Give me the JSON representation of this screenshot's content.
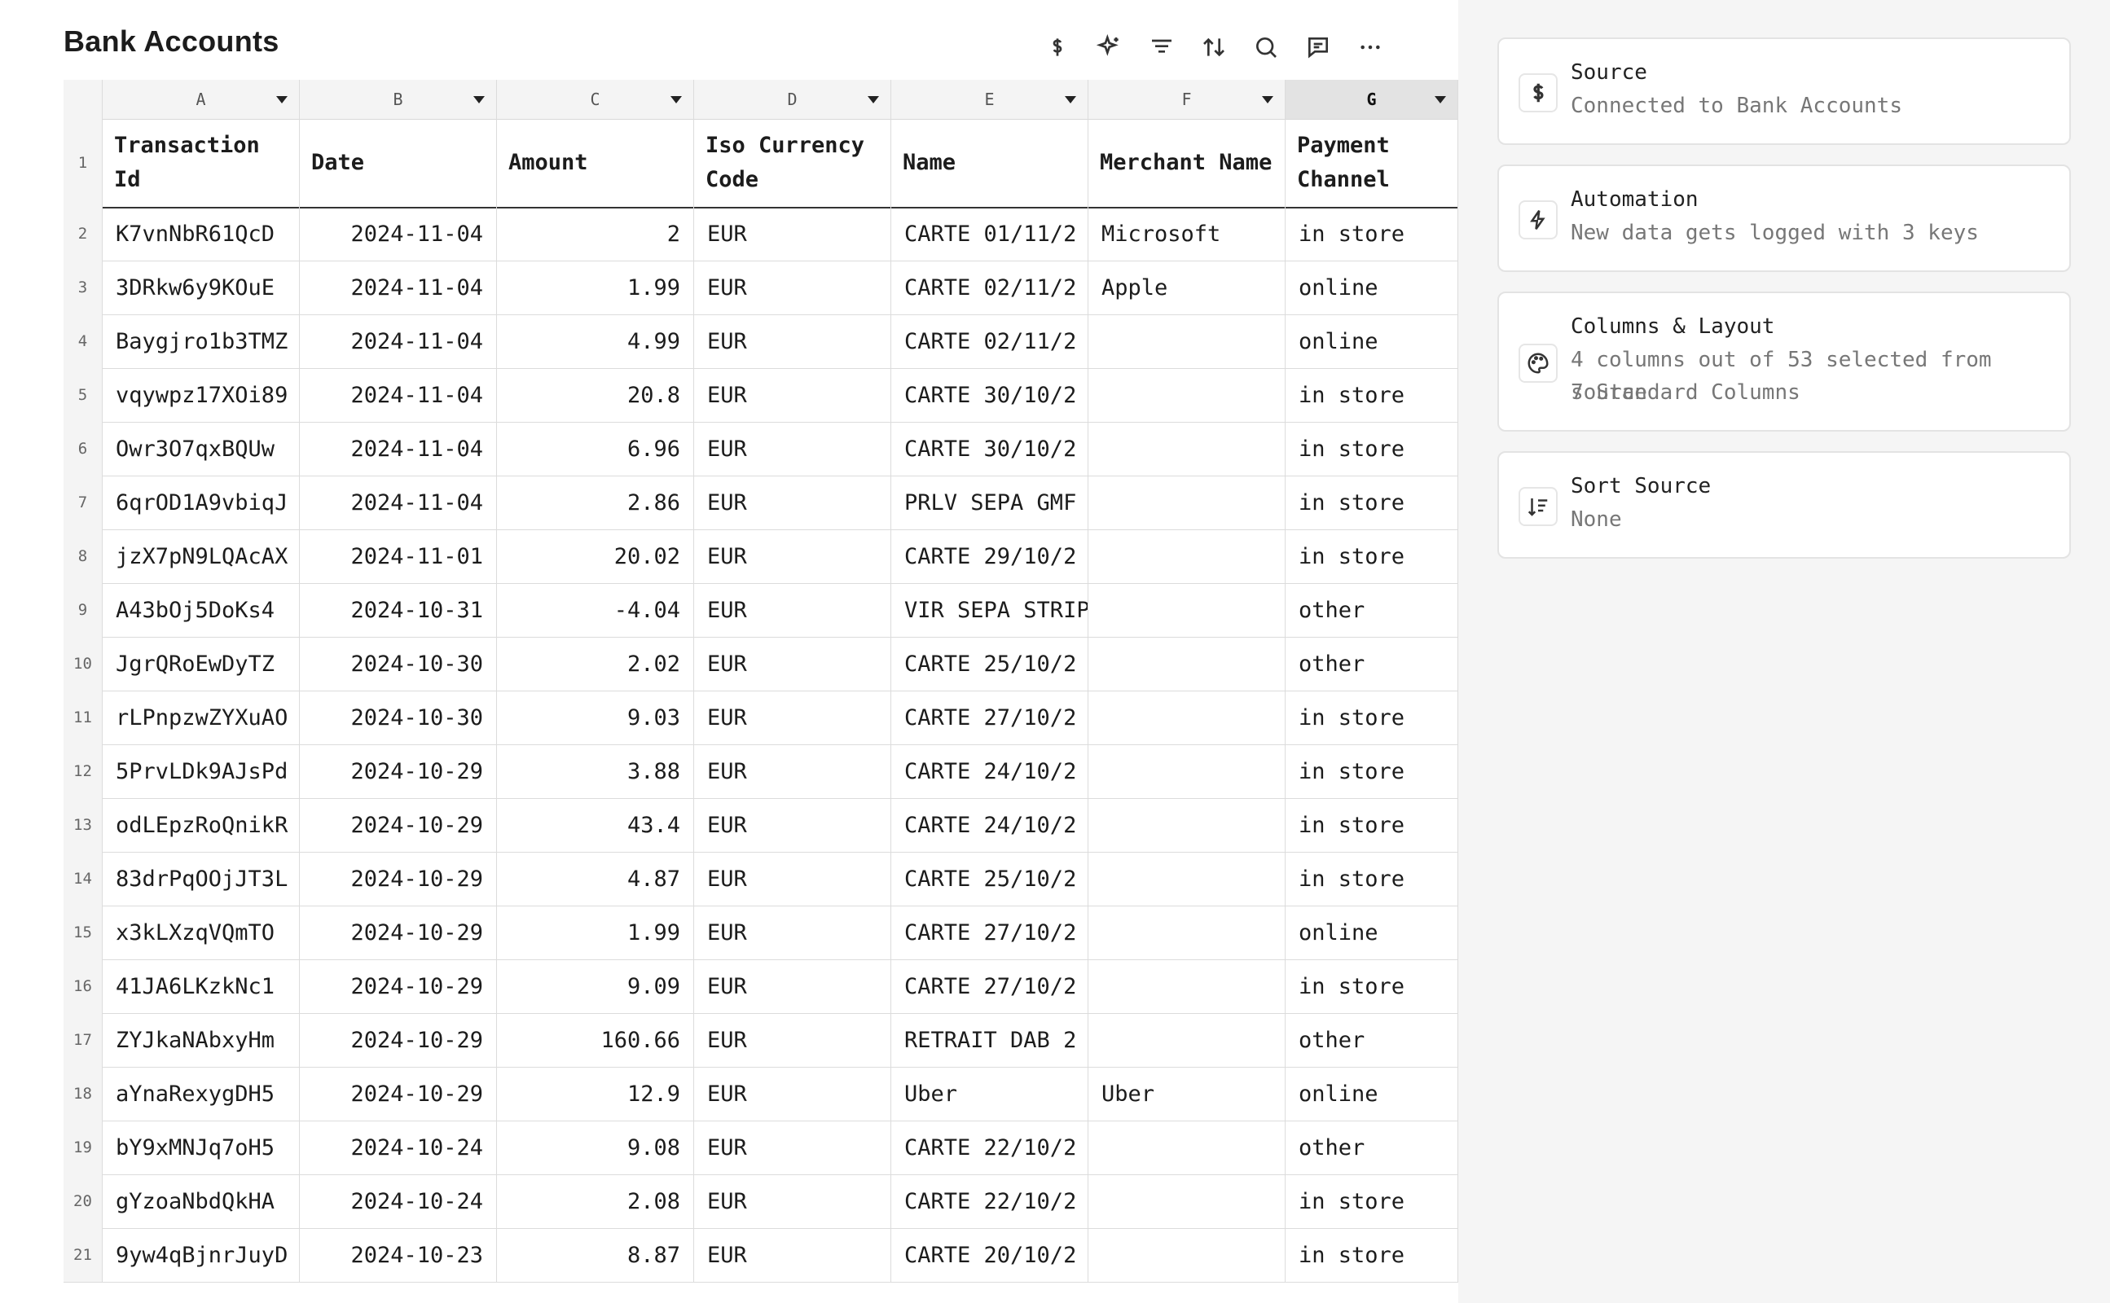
{
  "page_title": "Bank Accounts",
  "toolbar": {
    "icons": [
      "dollar-icon",
      "sparkle-icon",
      "filter-icon",
      "sort-icon",
      "search-icon",
      "comment-icon",
      "more-icon"
    ]
  },
  "columns": [
    {
      "letter": "A",
      "header": "Transaction Id"
    },
    {
      "letter": "B",
      "header": "Date"
    },
    {
      "letter": "C",
      "header": "Amount"
    },
    {
      "letter": "D",
      "header": "Iso Currency Code"
    },
    {
      "letter": "E",
      "header": "Name"
    },
    {
      "letter": "F",
      "header": "Merchant Name"
    },
    {
      "letter": "G",
      "header": "Payment Channel"
    }
  ],
  "header_row_number": "1",
  "rows": [
    {
      "n": "2",
      "id": "K7vnNbR61QcD",
      "date": "2024-11-04",
      "amount": "2",
      "cur": "EUR",
      "name": "CARTE 01/11/2",
      "merchant": "Microsoft",
      "channel": "in store"
    },
    {
      "n": "3",
      "id": "3DRkw6y9KOuE",
      "date": "2024-11-04",
      "amount": "1.99",
      "cur": "EUR",
      "name": "CARTE 02/11/2",
      "merchant": "Apple",
      "channel": "online"
    },
    {
      "n": "4",
      "id": "Baygjro1b3TMZ",
      "date": "2024-11-04",
      "amount": "4.99",
      "cur": "EUR",
      "name": "CARTE 02/11/2",
      "merchant": "",
      "channel": "online"
    },
    {
      "n": "5",
      "id": "vqywpz17XOi89",
      "date": "2024-11-04",
      "amount": "20.8",
      "cur": "EUR",
      "name": "CARTE 30/10/2",
      "merchant": "",
      "channel": "in store"
    },
    {
      "n": "6",
      "id": "Owr3O7qxBQUw",
      "date": "2024-11-04",
      "amount": "6.96",
      "cur": "EUR",
      "name": "CARTE 30/10/2",
      "merchant": "",
      "channel": "in store"
    },
    {
      "n": "7",
      "id": "6qrOD1A9vbiqJ",
      "date": "2024-11-04",
      "amount": "2.86",
      "cur": "EUR",
      "name": "PRLV SEPA GMF",
      "merchant": "",
      "channel": "in store"
    },
    {
      "n": "8",
      "id": "jzX7pN9LQAcAX",
      "date": "2024-11-01",
      "amount": "20.02",
      "cur": "EUR",
      "name": "CARTE 29/10/2",
      "merchant": "",
      "channel": "in store"
    },
    {
      "n": "9",
      "id": "A43bOj5DoKs4",
      "date": "2024-10-31",
      "amount": "-4.04",
      "cur": "EUR",
      "name": "VIR SEPA STRIP",
      "merchant": "",
      "channel": "other"
    },
    {
      "n": "10",
      "id": "JgrQRoEwDyTZ",
      "date": "2024-10-30",
      "amount": "2.02",
      "cur": "EUR",
      "name": "CARTE 25/10/2",
      "merchant": "",
      "channel": "other"
    },
    {
      "n": "11",
      "id": "rLPnpzwZYXuAO",
      "date": "2024-10-30",
      "amount": "9.03",
      "cur": "EUR",
      "name": "CARTE 27/10/2",
      "merchant": "",
      "channel": "in store"
    },
    {
      "n": "12",
      "id": "5PrvLDk9AJsPd",
      "date": "2024-10-29",
      "amount": "3.88",
      "cur": "EUR",
      "name": "CARTE 24/10/2",
      "merchant": "",
      "channel": "in store"
    },
    {
      "n": "13",
      "id": "odLEpzRoQnikR",
      "date": "2024-10-29",
      "amount": "43.4",
      "cur": "EUR",
      "name": "CARTE 24/10/2",
      "merchant": "",
      "channel": "in store"
    },
    {
      "n": "14",
      "id": "83drPqOOjJT3L",
      "date": "2024-10-29",
      "amount": "4.87",
      "cur": "EUR",
      "name": "CARTE 25/10/2",
      "merchant": "",
      "channel": "in store"
    },
    {
      "n": "15",
      "id": "x3kLXzqVQmTO",
      "date": "2024-10-29",
      "amount": "1.99",
      "cur": "EUR",
      "name": "CARTE 27/10/2",
      "merchant": "",
      "channel": "online"
    },
    {
      "n": "16",
      "id": "41JA6LKzkNc1",
      "date": "2024-10-29",
      "amount": "9.09",
      "cur": "EUR",
      "name": "CARTE 27/10/2",
      "merchant": "",
      "channel": "in store"
    },
    {
      "n": "17",
      "id": "ZYJkaNAbxyHm",
      "date": "2024-10-29",
      "amount": "160.66",
      "cur": "EUR",
      "name": "RETRAIT DAB 2",
      "merchant": "",
      "channel": "other"
    },
    {
      "n": "18",
      "id": "aYnaRexygDH5",
      "date": "2024-10-29",
      "amount": "12.9",
      "cur": "EUR",
      "name": "Uber",
      "merchant": "Uber",
      "channel": "online"
    },
    {
      "n": "19",
      "id": "bY9xMNJq7oH5",
      "date": "2024-10-24",
      "amount": "9.08",
      "cur": "EUR",
      "name": "CARTE 22/10/2",
      "merchant": "",
      "channel": "other"
    },
    {
      "n": "20",
      "id": "gYzoaNbdQkHA",
      "date": "2024-10-24",
      "amount": "2.08",
      "cur": "EUR",
      "name": "CARTE 22/10/2",
      "merchant": "",
      "channel": "in store"
    },
    {
      "n": "21",
      "id": "9yw4qBjnrJuyD",
      "date": "2024-10-23",
      "amount": "8.87",
      "cur": "EUR",
      "name": "CARTE 20/10/2",
      "merchant": "",
      "channel": "in store"
    }
  ],
  "panel": {
    "source": {
      "title": "Source",
      "subtitle": "Connected to Bank Accounts",
      "icon": "dollar-icon"
    },
    "automation": {
      "title": "Automation",
      "subtitle": "New data gets logged with 3 keys",
      "icon": "bolt-icon"
    },
    "columns_layout": {
      "title": "Columns & Layout",
      "line1": "4 columns out of 53 selected from source",
      "line2": "7 Standard Columns",
      "icon": "palette-icon"
    },
    "sort_source": {
      "title": "Sort Source",
      "subtitle": "None",
      "icon": "sort-lines-icon"
    }
  }
}
